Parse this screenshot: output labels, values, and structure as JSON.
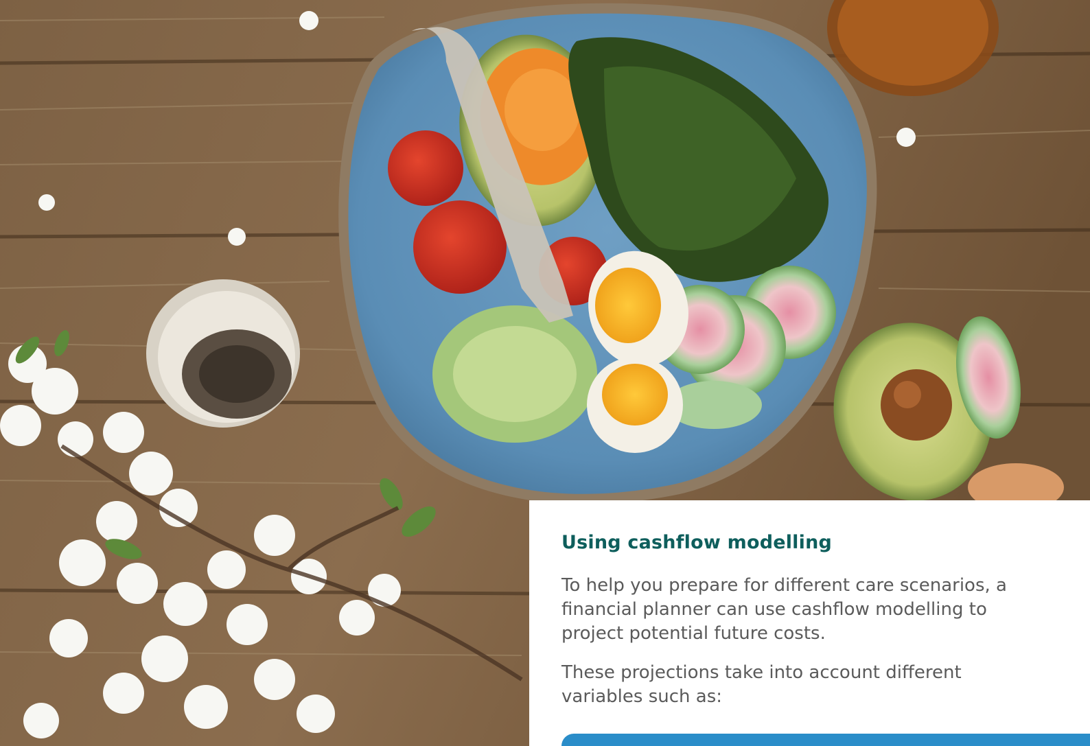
{
  "image": {
    "subject": "salad-bowl-photo"
  },
  "card": {
    "title": "Using cashflow modelling",
    "paragraphs": [
      "To help you prepare for different care scenarios, a financial planner can use cashflow modelling to project potential future costs.",
      "These projections take into account different variables such as:"
    ]
  },
  "colors": {
    "title": "#0e5e5c",
    "body_text": "#5a5a5a",
    "accent_strip": "#2a8dc9",
    "card_background": "#ffffff"
  }
}
